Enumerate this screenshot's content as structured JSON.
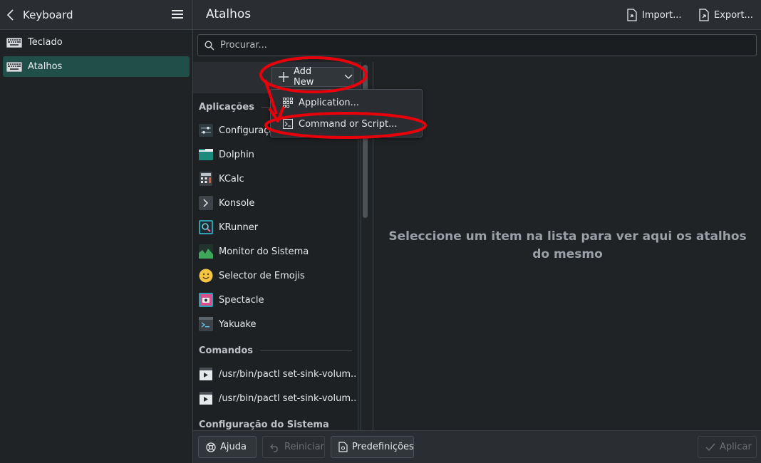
{
  "header": {
    "back_label": "Keyboard",
    "page_title": "Atalhos",
    "import_label": "Import...",
    "export_label": "Export..."
  },
  "sidebar": {
    "items": [
      {
        "label": "Teclado",
        "icon": "keyboard-icon",
        "active": false
      },
      {
        "label": "Atalhos",
        "icon": "keyboard-icon",
        "active": true
      }
    ]
  },
  "search": {
    "placeholder": "Procurar..."
  },
  "add_new": {
    "label": "Add New",
    "menu": [
      {
        "label": "Application...",
        "icon": "grid-icon"
      },
      {
        "label": "Command or Script...",
        "icon": "terminal-icon"
      }
    ]
  },
  "list": {
    "sections": [
      {
        "title": "Aplicações"
      },
      {
        "title": "Comandos"
      },
      {
        "title": "Configuração do Sistema"
      }
    ],
    "applications": [
      {
        "label": "Configuração",
        "icon": "system-settings-icon"
      },
      {
        "label": "Dolphin",
        "icon": "dolphin-folder-icon"
      },
      {
        "label": "KCalc",
        "icon": "calculator-icon"
      },
      {
        "label": "Konsole",
        "icon": "terminal-icon"
      },
      {
        "label": "KRunner",
        "icon": "krunner-search-icon"
      },
      {
        "label": "Monitor do Sistema",
        "icon": "system-monitor-icon"
      },
      {
        "label": "Selector de Emojis",
        "icon": "emoji-icon"
      },
      {
        "label": "Spectacle",
        "icon": "spectacle-camera-icon"
      },
      {
        "label": "Yakuake",
        "icon": "yakuake-terminal-icon"
      }
    ],
    "commands": [
      {
        "label": "/usr/bin/pactl set-sink-volum...",
        "icon": "script-icon"
      },
      {
        "label": "/usr/bin/pactl set-sink-volum...",
        "icon": "script-icon"
      }
    ]
  },
  "placeholder": {
    "text": "Seleccione um item na lista para ver aqui os atalhos do mesmo"
  },
  "footer": {
    "help_label": "Ajuda",
    "reset_label": "Reiniciar",
    "defaults_label": "Predefinições",
    "apply_label": "Aplicar"
  },
  "colors": {
    "accent": "#1f4f48",
    "annotation": "#e8000b",
    "background": "#202326"
  }
}
